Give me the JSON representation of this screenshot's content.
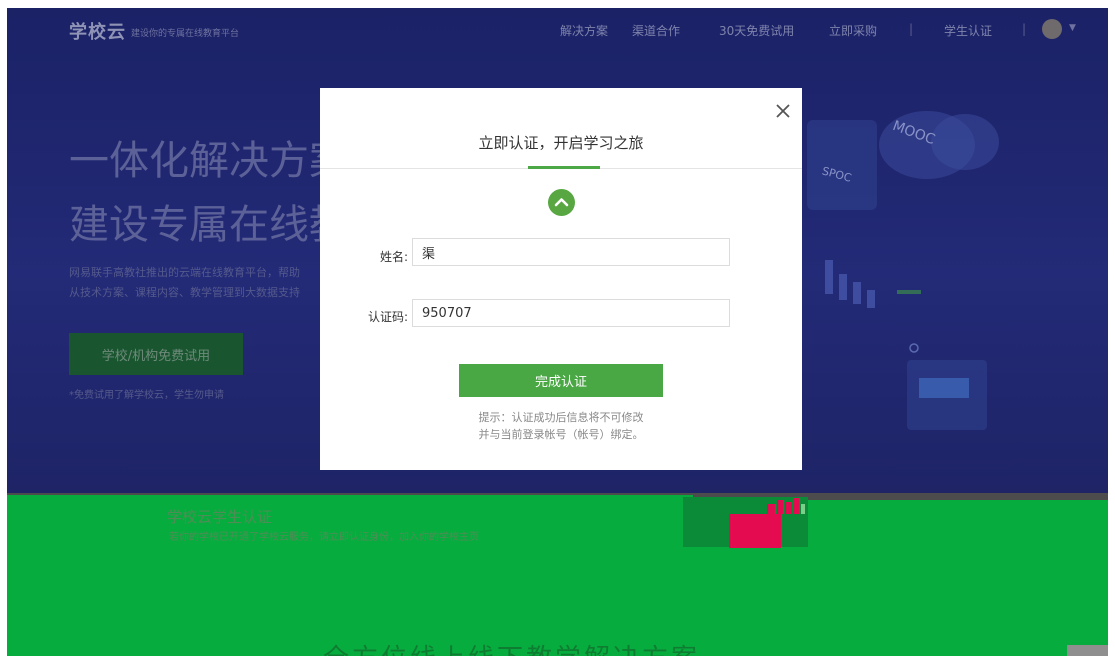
{
  "nav": {
    "logo": "学校云",
    "tagline": "建设你的专属在线教育平台",
    "links": [
      "解决方案",
      "渠道合作",
      "30天免费试用",
      "立即采购",
      "学生认证"
    ],
    "separator": "|"
  },
  "hero": {
    "title_line1": "一体化解决方案",
    "title_line2": "建设专属在线教",
    "desc_line1": "网易联手高教社推出的云端在线教育平台，帮助",
    "desc_line2": "从技术方案、课程内容、教学管理到大数据支持",
    "trial_button": "学校/机构免费试用",
    "trial_note": "*免费试用了解学校云，学生勿申请"
  },
  "illustration": {
    "badge_mooc": "MOOC",
    "badge_spoc": "SPOC"
  },
  "section": {
    "title": "学校云学生认证",
    "subtitle": "若你的学校已开通了学校云服务，请立即认证身份，加入你的学校主页",
    "bottom_heading": "全方位线上线下教学解决方案"
  },
  "modal": {
    "title": "立即认证，开启学习之旅",
    "name_label": "姓名:",
    "name_value": "渠",
    "code_label": "认证码:",
    "code_value": "950707",
    "submit_label": "完成认证",
    "hint_line1": "提示：认证成功后信息将不可修改",
    "hint_line2": "并与当前登录帐号（帐号）绑定。"
  },
  "colors": {
    "accent_green": "#4aa844",
    "hero_bg": "#22296b",
    "overlay_green": "#07ac3e",
    "overlay_pink": "#e50b50"
  },
  "icons": {
    "close": "close-icon",
    "chevron_up": "chevron-up-icon",
    "avatar": "avatar"
  }
}
